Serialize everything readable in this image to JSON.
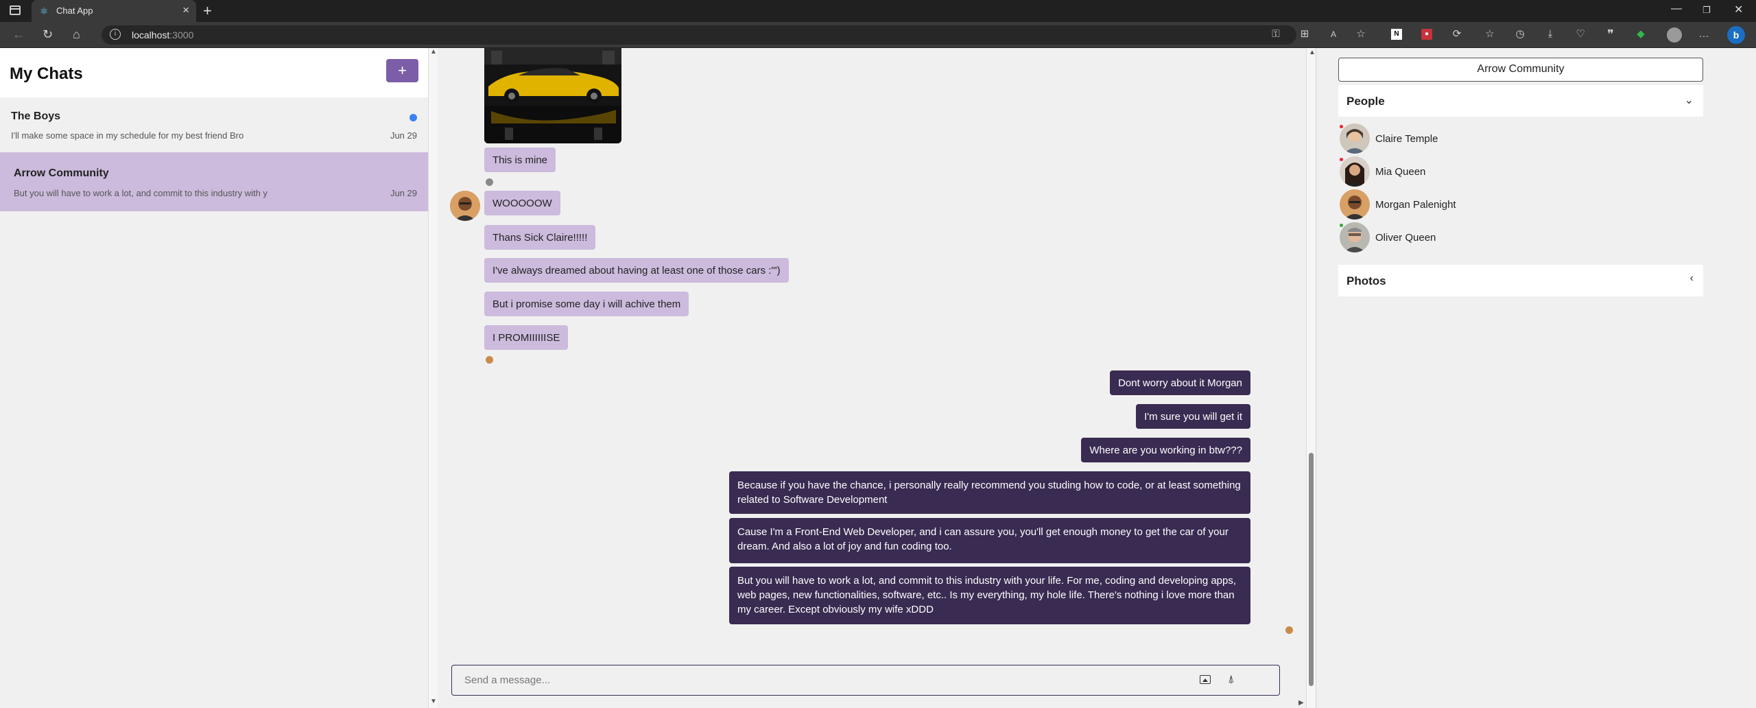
{
  "browser": {
    "tab_title": "Chat App",
    "url_host": "localhost",
    "url_port": ":3000"
  },
  "sidebar": {
    "title": "My Chats",
    "add_label": "+",
    "chats": [
      {
        "name": "The Boys",
        "preview": "I'll make some space in my schedule for my best friend Bro",
        "date": "Jun 29",
        "unread": true
      },
      {
        "name": "Arrow Community",
        "preview": "But you will have to work a lot, and commit to this industry with y",
        "date": "Jun 29",
        "selected": true
      }
    ]
  },
  "messages": [
    {
      "side": "in",
      "text": "This is mine"
    },
    {
      "side": "in",
      "text": "WOOOOOW"
    },
    {
      "side": "in",
      "text": "Thans Sick Claire!!!!!"
    },
    {
      "side": "in",
      "text": "I've always dreamed about having at least one of those cars :'\")"
    },
    {
      "side": "in",
      "text": "But i promise some day i will achive them"
    },
    {
      "side": "in",
      "text": "I PROMIIIIIISE"
    },
    {
      "side": "out",
      "text": "Dont worry about it Morgan"
    },
    {
      "side": "out",
      "text": "I'm sure you will get it"
    },
    {
      "side": "out",
      "text": "Where are you working in btw???"
    },
    {
      "side": "out",
      "text": "Because if you have the chance, i personally really recommend you studing how to code, or at least something related to Software Development"
    },
    {
      "side": "out",
      "text": "Cause I'm a Front-End Web Developer, and i can assure you, you'll get enough money to get the car of your dream. And also a lot of joy and fun coding too."
    },
    {
      "side": "out",
      "text": "But you will have to work a lot, and commit to this industry with your life. For me, coding and developing apps, web pages, new functionalities, software, etc.. Is my everything, my hole life. There's nothing i love more than my career. Except obviously my wife xDDD"
    }
  ],
  "composer": {
    "placeholder": "Send a message..."
  },
  "details": {
    "chat_name": "Arrow Community",
    "people_label": "People",
    "people": [
      {
        "name": "Claire Temple"
      },
      {
        "name": "Mia Queen"
      },
      {
        "name": "Morgan Palenight"
      },
      {
        "name": "Oliver Queen"
      }
    ],
    "photos_label": "Photos"
  },
  "colors": {
    "accent": "#7b5ea7",
    "incoming_bubble": "#ccbbdd",
    "outgoing_bubble": "#3a2b52",
    "unread_dot": "#3b82f6"
  }
}
